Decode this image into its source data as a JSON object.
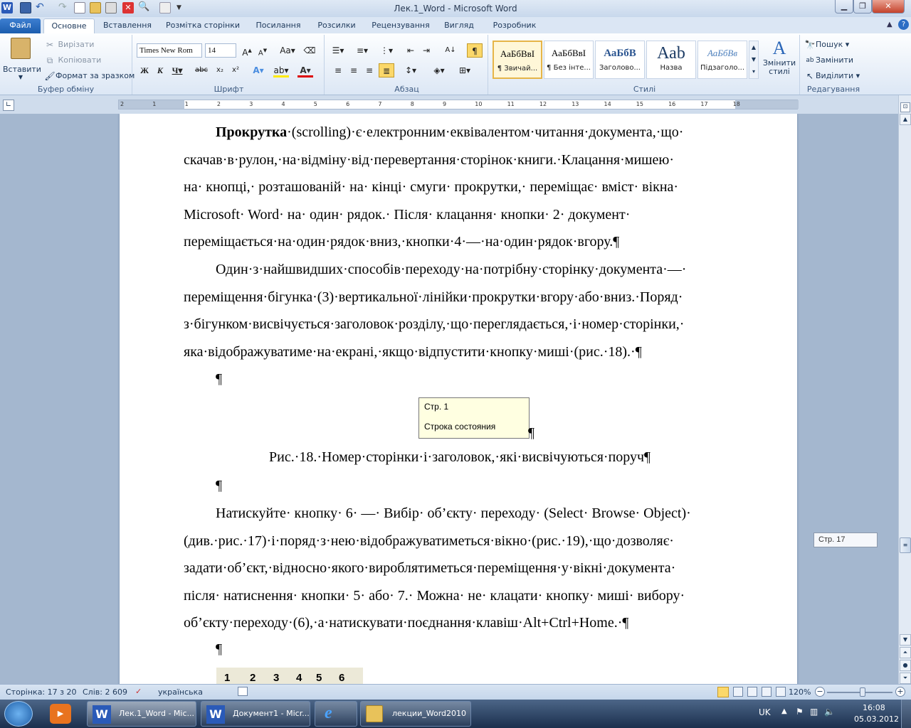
{
  "window": {
    "title": "Лек.1_Word  -  Microsoft Word"
  },
  "tabs": [
    "Файл",
    "Основне",
    "Вставлення",
    "Розмітка сторінки",
    "Посилання",
    "Розсилки",
    "Рецензування",
    "Вигляд",
    "Розробник"
  ],
  "clipboard": {
    "paste": "Вставити",
    "cut": "Вирізати",
    "copy": "Копіювати",
    "format_painter": "Формат за зразком",
    "label": "Буфер обміну"
  },
  "font": {
    "name": "Times New Rom",
    "size": "14",
    "label": "Шрифт"
  },
  "paragraph": {
    "label": "Абзац"
  },
  "styles": {
    "items": [
      {
        "sample": "АаБбВвІ",
        "name": "¶ Звичай..."
      },
      {
        "sample": "АаБбВвІ",
        "name": "¶ Без інте..."
      },
      {
        "sample": "АаБбВ",
        "name": "Заголово..."
      },
      {
        "sample": "Ааb",
        "name": "Назва"
      },
      {
        "sample": "АаБбВв",
        "name": "Підзаголо..."
      }
    ],
    "change": "Змінити стилі",
    "label": "Стилі"
  },
  "editing": {
    "find": "Пошук",
    "replace": "Замінити",
    "select": "Виділити",
    "label": "Редагування"
  },
  "ruler_numbers": [
    "2",
    "1",
    "1",
    "2",
    "3",
    "4",
    "5",
    "6",
    "7",
    "8",
    "9",
    "10",
    "11",
    "12",
    "13",
    "14",
    "15",
    "16",
    "17",
    "18"
  ],
  "document": {
    "p1_bold": "Прокрутка",
    "p1_lines": [
      "(scrolling)·є·електронним·еквівалентом·читання·документа,·що·",
      "скачав·в·рулон,·на·відміну·від·перевертання·сторінок·книги.·Клацання·мишею·",
      "на· кнопці,· розташованій· на· кінці· смуги· прокрутки,· переміщає· вміст· вікна·",
      "Microsoft· Word· на· один· рядок.· Після· клацання· кнопки· 2· документ·",
      "переміщається·на·один·рядок·вниз,·кнопки·4·—·на·один·рядок·вгору.¶"
    ],
    "p2_lines": [
      "Один·з·найшвидших·способів·переходу·на·потрібну·сторінку·документа·—·",
      "переміщення·бігунка·(3)·вертикальної·лінійки·прокрутки·вгору·або·вниз.·Поряд·",
      "з·бігунком·висвічується·заголовок·розділу,·що·переглядається,·і·номер·сторінки,·",
      "яка·відображуватиме·на·екрані,·якщо·відпустити·кнопку·миші·(рис.·18).·¶"
    ],
    "empty_mark": "¶",
    "figure_tip": {
      "line1": "Стр. 1",
      "line2": "Строка состояния"
    },
    "caption": "Рис.·18.·Номер·сторінки·і·заголовок,·які·висвічуються·поруч¶",
    "p3_lines": [
      "Натискуйте· кнопку· 6· —· Вибір· об’єкту· переходу· (Select· Browse· Object)·",
      "(див.·рис.·17)·і·поряд·з·нею·відображуватиметься·вікно·(рис.·19),·що·дозволяє·",
      "задати·об’єкт,·відносно·якого·вироблятиметься·переміщення·у·вікні·документа·",
      "після· натиснення· кнопки· 5· або· 7.· Можна· не· клацати· кнопку· миші· вибору·",
      "об’єкту·переходу·(6),·а·натискувати·поєднання·клавіш·Alt+Ctrl+Home.·¶"
    ],
    "toolbar_nums": [
      "1",
      "2",
      "3",
      "4",
      "5",
      "6"
    ]
  },
  "scroll_tip": "Стр. 17",
  "status": {
    "page": "Сторінка: 17 з 20",
    "words": "Слів: 2 609",
    "lang": "українська",
    "zoom": "120%"
  },
  "taskbar": {
    "items": [
      "Лек.1_Word - Mic...",
      "Документ1 - Micr...",
      "",
      "лекции_Word2010"
    ],
    "lang": "UK",
    "time": "16:08",
    "date": "05.03.2012"
  }
}
